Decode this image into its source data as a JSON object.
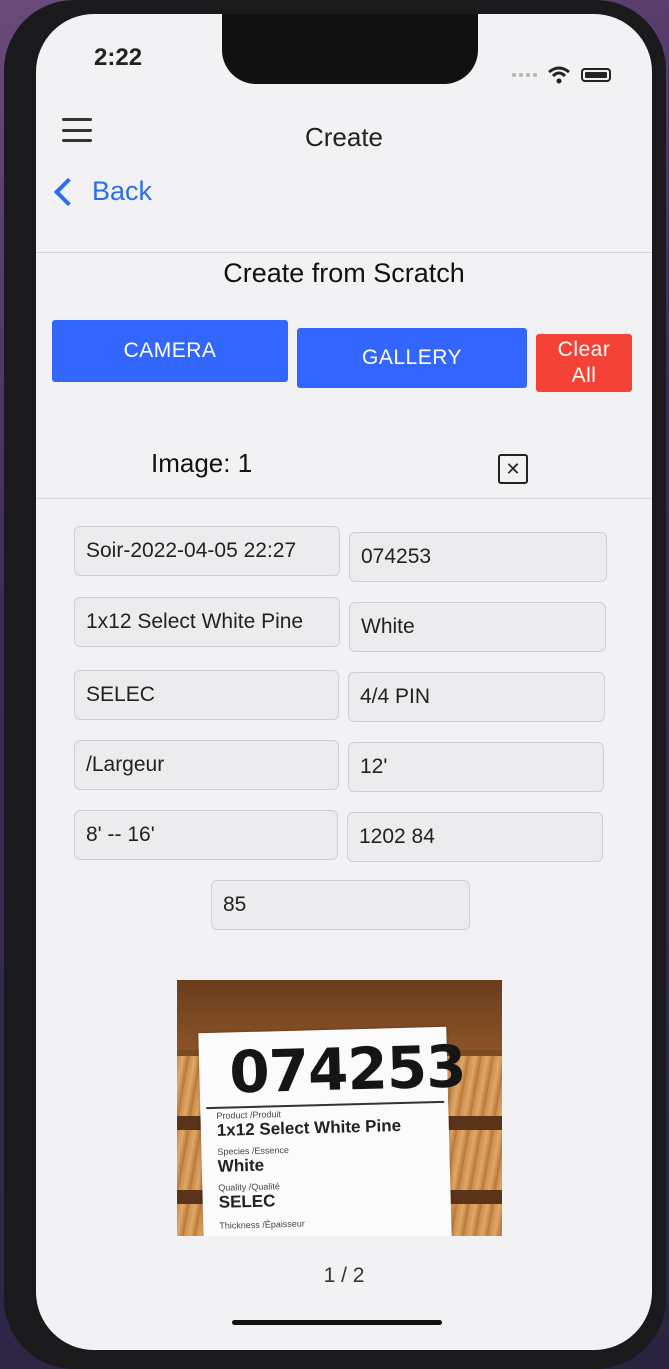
{
  "status_bar": {
    "time": "2:22"
  },
  "nav": {
    "title": "Create",
    "back_label": "Back"
  },
  "section_title": "Create from Scratch",
  "buttons": {
    "camera": "CAMERA",
    "gallery": "GALLERY",
    "clear_line1": "Clear",
    "clear_line2": "All"
  },
  "image_header": "Image: 1",
  "close_symbol": "✕",
  "fields": [
    "Soir-2022-04-05 22:27",
    "074253",
    "1x12 Select White Pine",
    "White",
    "SELEC",
    "4/4 PIN",
    "/Largeur",
    "12'",
    "8' -- 16'",
    "1202 84",
    "85"
  ],
  "photo_tag": {
    "number": "074253",
    "product_label": "Product /Produit",
    "product_value": "1x12 Select White Pine",
    "species_label": "Species /Essence",
    "species_value": "White",
    "quality_label": "Quality /Qualité",
    "quality_value": "SELEC",
    "thickness_label": "Thickness /Épaisseur"
  },
  "pager": "1 / 2",
  "icons": [
    "hamburger-menu-icon",
    "chevron-left-icon",
    "close-icon",
    "wifi-icon",
    "battery-icon",
    "signal-icon"
  ]
}
